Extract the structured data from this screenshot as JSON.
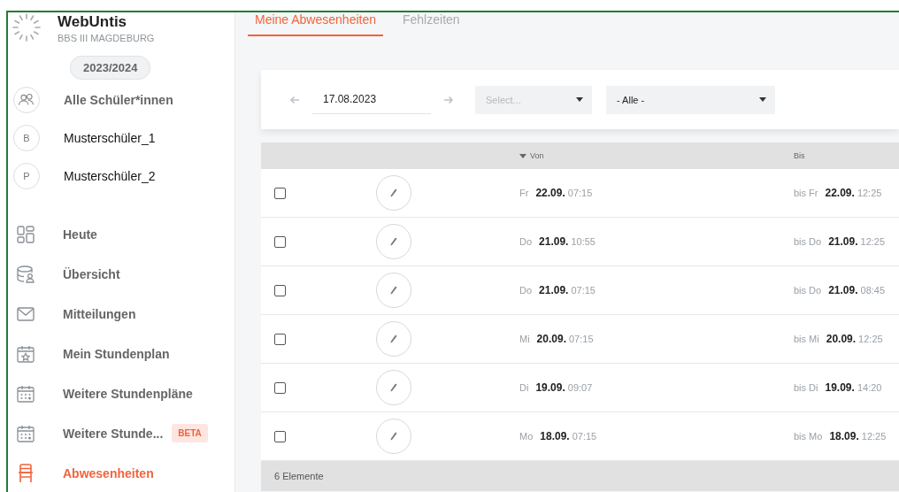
{
  "sidebar": {
    "app_name": "WebUntis",
    "school": "BBS III MAGDEBURG",
    "year": "2023/2024",
    "people": [
      {
        "kind": "group",
        "name": "Alle Schüler*innen"
      },
      {
        "kind": "person",
        "avatar": "B",
        "name": "Musterschüler_1"
      },
      {
        "kind": "person",
        "avatar": "P",
        "name": "Musterschüler_2"
      }
    ],
    "nav": [
      {
        "kind": "dashboard",
        "label": "Heute",
        "selected": false
      },
      {
        "kind": "overview",
        "label": "Übersicht",
        "selected": false
      },
      {
        "kind": "mail",
        "label": "Mitteilungen",
        "selected": false
      },
      {
        "kind": "calendar-star",
        "label": "Mein Stundenplan",
        "selected": false
      },
      {
        "kind": "calendar",
        "label": "Weitere Stundenpläne",
        "selected": false
      },
      {
        "kind": "calendar",
        "label": "Weitere Stunde...",
        "badge": "BETA",
        "selected": false
      },
      {
        "kind": "chair",
        "label": "Abwesenheiten",
        "selected": true
      }
    ]
  },
  "tabs": [
    {
      "label": "Meine Abwesenheiten",
      "selected": true
    },
    {
      "label": "Fehlzeiten",
      "selected": false
    }
  ],
  "filters": {
    "date": "17.08.2023",
    "select_1": {
      "placeholder": "Select..."
    },
    "select_2": {
      "value": "- Alle -"
    }
  },
  "table": {
    "columns": [
      {
        "label": "Von",
        "sorted": true
      },
      {
        "label": "Bis",
        "sorted": false
      }
    ],
    "rows": [
      {
        "checked": false,
        "from_day": "Fr",
        "from_date": "22.09.",
        "from_time": "07:15",
        "to_day": "bis Fr",
        "to_date": "22.09.",
        "to_time": "12:25"
      },
      {
        "checked": false,
        "from_day": "Do",
        "from_date": "21.09.",
        "from_time": "10:55",
        "to_day": "bis Do",
        "to_date": "21.09.",
        "to_time": "12:25"
      },
      {
        "checked": false,
        "from_day": "Do",
        "from_date": "21.09.",
        "from_time": "07:15",
        "to_day": "bis Do",
        "to_date": "21.09.",
        "to_time": "08:45"
      },
      {
        "checked": false,
        "from_day": "Mi",
        "from_date": "20.09.",
        "from_time": "07:15",
        "to_day": "bis Mi",
        "to_date": "20.09.",
        "to_time": "12:25"
      },
      {
        "checked": false,
        "from_day": "Di",
        "from_date": "19.09.",
        "from_time": "09:07",
        "to_day": "bis Di",
        "to_date": "19.09.",
        "to_time": "14:20"
      },
      {
        "checked": false,
        "from_day": "Mo",
        "from_date": "18.09.",
        "from_time": "07:15",
        "to_day": "bis Mo",
        "to_date": "18.09.",
        "to_time": "12:25"
      }
    ],
    "footer": "6 Elemente"
  }
}
